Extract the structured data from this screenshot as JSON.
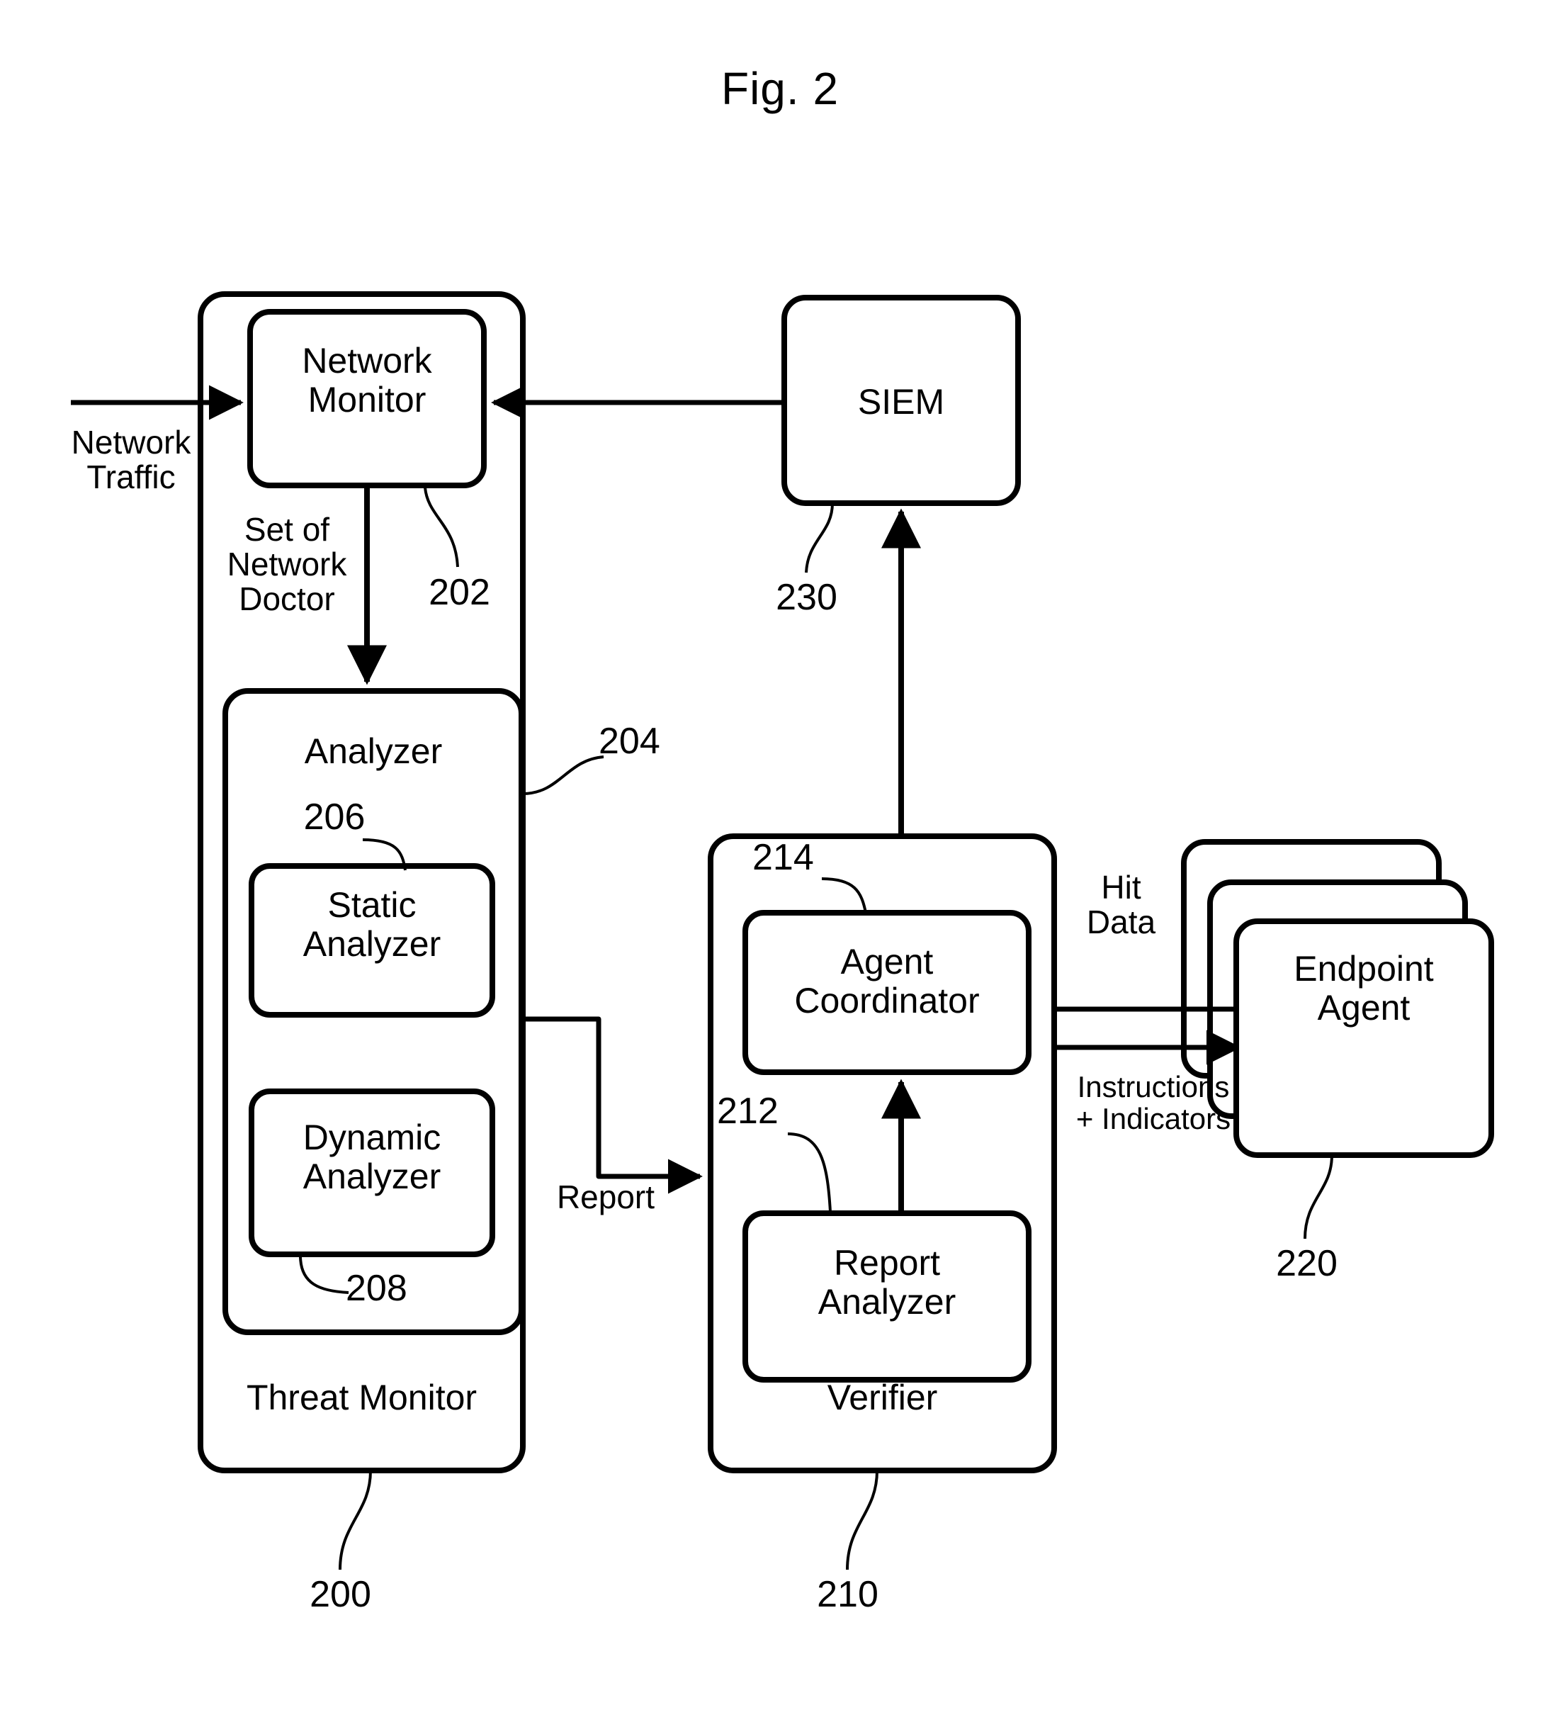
{
  "figure": {
    "title": "Fig. 2"
  },
  "boxes": {
    "network_monitor": "Network\nMonitor",
    "analyzer": "Analyzer",
    "static_analyzer": "Static\nAnalyzer",
    "dynamic_analyzer": "Dynamic\nAnalyzer",
    "threat_monitor": "Threat Monitor",
    "siem": "SIEM",
    "agent_coordinator": "Agent\nCoordinator",
    "report_analyzer": "Report\nAnalyzer",
    "verifier": "Verifier",
    "endpoint_agent": "Endpoint\nAgent"
  },
  "flow_labels": {
    "network_traffic": "Network\nTraffic",
    "set_of_network_doctor": "Set of\nNetwork\nDoctor",
    "report": "Report",
    "hit_data": "Hit\nData",
    "instructions_indicators": "Instructions\n+ Indicators"
  },
  "reference_numerals": {
    "threat_monitor": "200",
    "network_monitor": "202",
    "analyzer": "204",
    "static_analyzer": "206",
    "dynamic_analyzer": "208",
    "verifier": "210",
    "report_analyzer": "212",
    "agent_coordinator": "214",
    "endpoint_agent": "220",
    "siem": "230"
  },
  "colors": {
    "stroke": "#000000",
    "background": "#ffffff"
  }
}
